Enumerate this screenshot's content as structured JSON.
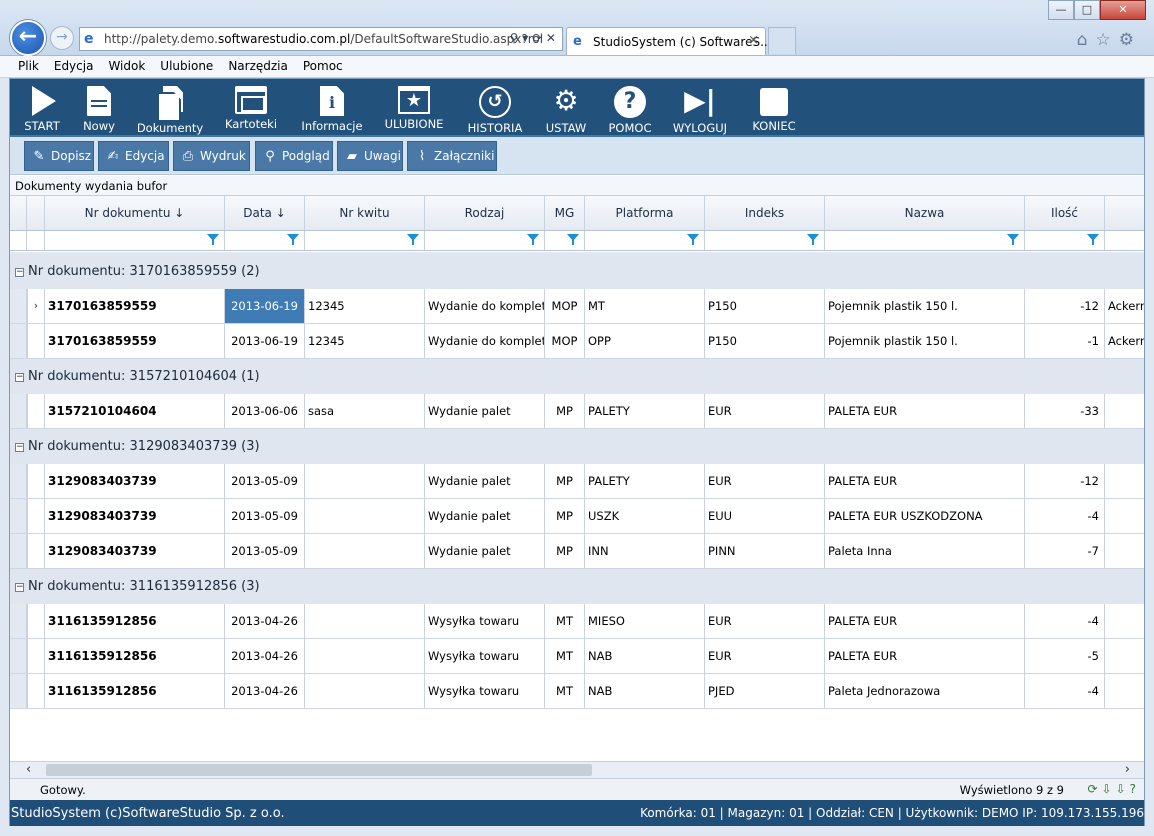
{
  "browser": {
    "url_prefix": "http://palety.demo.",
    "url_domain": "softwarestudio.com.pl",
    "url_suffix": "/DefaultSoftwareStudio.aspx?rol",
    "tab_title": "StudioSystem (c) SoftwareS...",
    "tab_close": "×",
    "window_buttons": [
      "—",
      "□",
      "✕"
    ]
  },
  "menu": [
    "Plik",
    "Edycja",
    "Widok",
    "Ulubione",
    "Narzędzia",
    "Pomoc"
  ],
  "toolbar": [
    {
      "label": "START",
      "icon": "play-icon"
    },
    {
      "label": "Nowy",
      "icon": "new-document-icon"
    },
    {
      "label": "Dokumenty",
      "icon": "documents-icon"
    },
    {
      "label": "Kartoteki",
      "icon": "card-index-icon"
    },
    {
      "label": "Informacje",
      "icon": "info-icon"
    },
    {
      "label": "ULUBIONE",
      "icon": "favorites-icon"
    },
    {
      "label": "HISTORIA",
      "icon": "history-icon"
    },
    {
      "label": "USTAW",
      "icon": "settings-gear-icon"
    },
    {
      "label": "POMOC",
      "icon": "help-icon"
    },
    {
      "label": "WYLOGUJ",
      "icon": "logout-icon"
    },
    {
      "label": "KONIEC",
      "icon": "exit-icon"
    }
  ],
  "actions": [
    {
      "label": "Dopisz",
      "icon": "wrench-icon"
    },
    {
      "label": "Edycja",
      "icon": "edit-icon"
    },
    {
      "label": "Wydruk",
      "icon": "print-icon"
    },
    {
      "label": "Podgląd",
      "icon": "magnifier-icon"
    },
    {
      "label": "Uwagi",
      "icon": "note-icon"
    },
    {
      "label": "Załączniki",
      "icon": "paperclip-icon"
    }
  ],
  "section_title": "Dokumenty wydania bufor",
  "grid": {
    "columns": [
      "Nr dokumentu ↓",
      "Data ↓",
      "Nr kwitu",
      "Rodzaj",
      "MG",
      "Platforma",
      "Indeks",
      "Nazwa",
      "Ilość",
      ""
    ],
    "groups": [
      {
        "label": "Nr dokumentu: 3170163859559 (2)",
        "rows": [
          {
            "nr": "3170163859559",
            "data": "2013-06-19",
            "kwit": "12345",
            "rodzaj": "Wydanie do komplet",
            "mg": "MOP",
            "platforma": "MT",
            "indeks": "P150",
            "nazwa": "Pojemnik plastik 150 l.",
            "ilosc": "-12",
            "extra": "Ackerm",
            "current": true
          },
          {
            "nr": "3170163859559",
            "data": "2013-06-19",
            "kwit": "12345",
            "rodzaj": "Wydanie do komplet",
            "mg": "MOP",
            "platforma": "OPP",
            "indeks": "P150",
            "nazwa": "Pojemnik plastik 150 l.",
            "ilosc": "-1",
            "extra": "Ackerm"
          }
        ]
      },
      {
        "label": "Nr dokumentu: 3157210104604 (1)",
        "rows": [
          {
            "nr": "3157210104604",
            "data": "2013-06-06",
            "kwit": "sasa",
            "rodzaj": "Wydanie palet",
            "mg": "MP",
            "platforma": "PALETY",
            "indeks": "EUR",
            "nazwa": "PALETA EUR",
            "ilosc": "-33",
            "extra": ""
          }
        ]
      },
      {
        "label": "Nr dokumentu: 3129083403739 (3)",
        "rows": [
          {
            "nr": "3129083403739",
            "data": "2013-05-09",
            "kwit": "",
            "rodzaj": "Wydanie palet",
            "mg": "MP",
            "platforma": "PALETY",
            "indeks": "EUR",
            "nazwa": "PALETA EUR",
            "ilosc": "-12",
            "extra": ""
          },
          {
            "nr": "3129083403739",
            "data": "2013-05-09",
            "kwit": "",
            "rodzaj": "Wydanie palet",
            "mg": "MP",
            "platforma": "USZK",
            "indeks": "EUU",
            "nazwa": "PALETA EUR USZKODZONA",
            "ilosc": "-4",
            "extra": ""
          },
          {
            "nr": "3129083403739",
            "data": "2013-05-09",
            "kwit": "",
            "rodzaj": "Wydanie palet",
            "mg": "MP",
            "platforma": "INN",
            "indeks": "PINN",
            "nazwa": "Paleta Inna",
            "ilosc": "-7",
            "extra": ""
          }
        ]
      },
      {
        "label": "Nr dokumentu: 3116135912856 (3)",
        "rows": [
          {
            "nr": "3116135912856",
            "data": "2013-04-26",
            "kwit": "",
            "rodzaj": "Wysyłka towaru",
            "mg": "MT",
            "platforma": "MIESO",
            "indeks": "EUR",
            "nazwa": "PALETA EUR",
            "ilosc": "-4",
            "extra": ""
          },
          {
            "nr": "3116135912856",
            "data": "2013-04-26",
            "kwit": "",
            "rodzaj": "Wysyłka towaru",
            "mg": "MT",
            "platforma": "NAB",
            "indeks": "EUR",
            "nazwa": "PALETA EUR",
            "ilosc": "-5",
            "extra": ""
          },
          {
            "nr": "3116135912856",
            "data": "2013-04-26",
            "kwit": "",
            "rodzaj": "Wysyłka towaru",
            "mg": "MT",
            "platforma": "NAB",
            "indeks": "PJED",
            "nazwa": "Paleta Jednorazowa",
            "ilosc": "-4",
            "extra": ""
          }
        ]
      }
    ]
  },
  "status": {
    "left": "Gotowy.",
    "right": "Wyświetlono 9 z 9"
  },
  "footer": {
    "left": "StudioSystem (c)SoftwareStudio Sp. z o.o.",
    "right": "Komórka: 01 | Magazyn: 01 | Oddział: CEN | Użytkownik: DEMO IP: 109.173.155.196"
  },
  "colors": {
    "toolbar_bg": "#22527c",
    "action_button": "#4a79a8",
    "selected_cell": "#3f7cb6",
    "footer_bg": "#1f4e79"
  }
}
